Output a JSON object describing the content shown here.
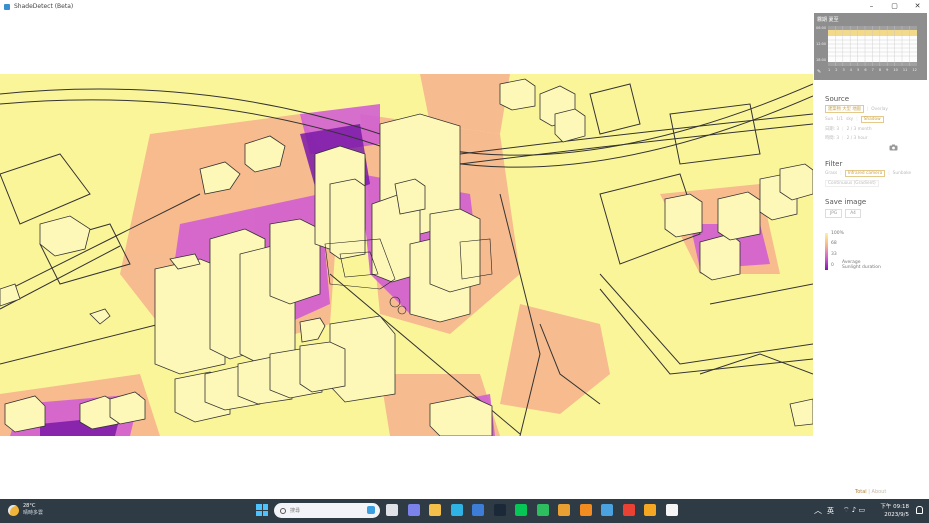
{
  "window": {
    "title": "ShadeDetect (Beta)",
    "controls": {
      "minimize": "–",
      "maximize": "▢",
      "close": "✕"
    }
  },
  "heatmap": {
    "label": "霧期 夏至",
    "y_labels": [
      "06:00",
      "12:00",
      "18:00"
    ],
    "x_labels": [
      "1",
      "2",
      "3",
      "4",
      "5",
      "6",
      "7",
      "8",
      "9",
      "10",
      "11",
      "12"
    ],
    "tool_icon": "pen-icon"
  },
  "source": {
    "title": "Source",
    "modes": [
      {
        "label": "建築物 大型 地圖",
        "style": "box-active"
      },
      {
        "label": "Overlay",
        "style": "muted"
      }
    ],
    "row2": [
      {
        "label": "Sun",
        "style": "muted"
      },
      {
        "label": "1/1",
        "style": "muted"
      },
      {
        "label": "sky",
        "style": "muted"
      },
      {
        "label": "Shadow",
        "style": "box-active"
      }
    ],
    "row3": [
      {
        "label": "日期: 3",
        "style": "muted"
      },
      {
        "label": "2 / 3 month",
        "style": "muted"
      }
    ],
    "row4": [
      {
        "label": "時間: 3",
        "style": "muted"
      },
      {
        "label": "2 / 3 hour",
        "style": "muted"
      }
    ]
  },
  "filter": {
    "title": "Filter",
    "row1": [
      {
        "label": "Grass",
        "style": "muted"
      },
      {
        "label": "Infrared camera",
        "style": "box-active"
      },
      {
        "label": "Sunbake",
        "style": "muted"
      }
    ],
    "row2": [
      {
        "label": "Continuous (Gradient)",
        "style": "muted-box"
      }
    ]
  },
  "save_image": {
    "title": "Save image",
    "buttons": [
      "JPG",
      "A4"
    ]
  },
  "legend": {
    "labels": [
      "100%",
      "68",
      "33",
      "0"
    ],
    "caption_1": "Average",
    "caption_2": "Sunlight duration"
  },
  "footer": {
    "link_a": "Total",
    "link_b": "| About"
  },
  "taskbar": {
    "weather_temp": "28°C",
    "weather_desc": "晴時多雲",
    "search_placeholder": "搜尋",
    "ime": "英",
    "time": "下午 09:18",
    "date": "2023/9/5",
    "app_icons": [
      {
        "name": "task-view-icon",
        "color": "#dfe3e8"
      },
      {
        "name": "teams-icon",
        "color": "#7b83eb"
      },
      {
        "name": "file-explorer-icon",
        "color": "#f4c04a"
      },
      {
        "name": "edge-icon",
        "color": "#2fb3e4"
      },
      {
        "name": "word-icon",
        "color": "#3d7dd8"
      },
      {
        "name": "steam-icon",
        "color": "#1b2838"
      },
      {
        "name": "line-icon",
        "color": "#06c755"
      },
      {
        "name": "evernote-icon",
        "color": "#2dbe60"
      },
      {
        "name": "archive-icon",
        "color": "#e8a032"
      },
      {
        "name": "avast-icon",
        "color": "#f28b20"
      },
      {
        "name": "shadedetect-app-icon",
        "color": "#4aa3df"
      },
      {
        "name": "chrome-icon",
        "color": "#e94235"
      },
      {
        "name": "rss-icon",
        "color": "#f5a623"
      },
      {
        "name": "file-icon",
        "color": "#f5f5f5"
      }
    ]
  },
  "colors": {
    "sunlit": "#fbf59a",
    "partial": "#f6b58d",
    "shade": "#d25fd1",
    "deep_shade": "#7b1aa8",
    "accent": "#c9a24d"
  }
}
